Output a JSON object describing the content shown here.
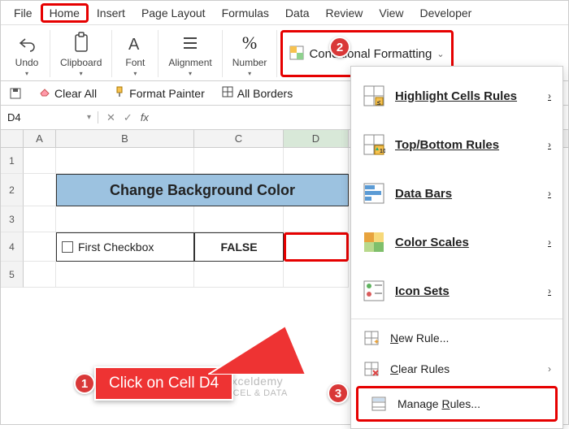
{
  "tabs": [
    "File",
    "Home",
    "Insert",
    "Page Layout",
    "Formulas",
    "Data",
    "Review",
    "View",
    "Developer"
  ],
  "ribbon": {
    "undo": "Undo",
    "clipboard": "Clipboard",
    "font": "Font",
    "alignment": "Alignment",
    "number": "Number",
    "number_symbol": "%",
    "cf_label": "Conditional Formatting"
  },
  "qat": {
    "clear_all": "Clear All",
    "format_painter": "Format Painter",
    "all_borders": "All Borders"
  },
  "namebox": "D4",
  "fx": "fx",
  "cols": {
    "a": "A",
    "b": "B",
    "c": "C",
    "d": "D"
  },
  "rows": [
    "1",
    "2",
    "3",
    "4",
    "5"
  ],
  "sheet": {
    "title": "Change Background Color",
    "checkbox_label": "First Checkbox",
    "c4": "FALSE"
  },
  "dropdown": {
    "highlight": "Highlight Cells Rules",
    "topbottom": "Top/Bottom Rules",
    "databars": "Data Bars",
    "colorscales": "Color Scales",
    "iconsets": "Icon Sets",
    "newrule_pre": "N",
    "newrule": "ew Rule...",
    "clearrules_pre": "C",
    "clearrules": "lear Rules",
    "manage_pre": "Manage ",
    "manage_u": "R",
    "manage_post": "ules..."
  },
  "badges": {
    "b1": "1",
    "b2": "2",
    "b3": "3"
  },
  "callout": "Click on Cell D4",
  "watermark": {
    "l1": "exceldemy",
    "l2": "EXCEL & DATA"
  }
}
